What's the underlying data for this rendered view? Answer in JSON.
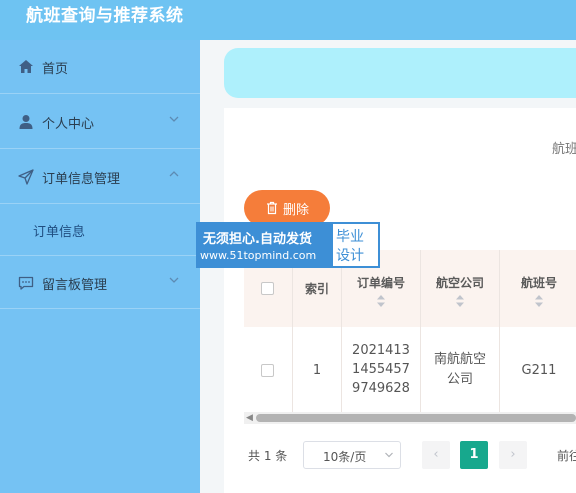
{
  "app": {
    "title": "航班查询与推荐系统"
  },
  "sidebar": {
    "items": [
      {
        "label": "首页",
        "icon": "home-icon"
      },
      {
        "label": "个人中心",
        "icon": "user-icon"
      },
      {
        "label": "订单信息管理",
        "icon": "send-icon"
      },
      {
        "label": "留言板管理",
        "icon": "message-icon"
      }
    ],
    "subitems": [
      {
        "label": "订单信息"
      }
    ]
  },
  "main": {
    "cut_heading": "航班",
    "delete_label": "删除",
    "table": {
      "headers": [
        "索引",
        "订单编号",
        "航空公司",
        "航班号"
      ],
      "rows": [
        {
          "index": "1",
          "order_no_lines": [
            "2021413",
            "1455457",
            "9749628"
          ],
          "airline_lines": [
            "南航航空",
            "公司"
          ],
          "flight_no": "G211"
        }
      ]
    },
    "pagination": {
      "total": "共 1 条",
      "page_size": "10条/页",
      "prev": "‹",
      "current_page": "1",
      "next": "›",
      "goto": "前往"
    }
  },
  "watermark": {
    "line1": "无须担心.自动发货",
    "line2": "www.51topmind.com",
    "right_line1": "毕业",
    "right_line2": "设计"
  },
  "colors": {
    "header_bg": "#6ec3f2",
    "sidebar_bg": "#75c2f3",
    "delete_button": "#f57d3a",
    "active_page": "#17a88d",
    "banner": "#aef0fc"
  }
}
